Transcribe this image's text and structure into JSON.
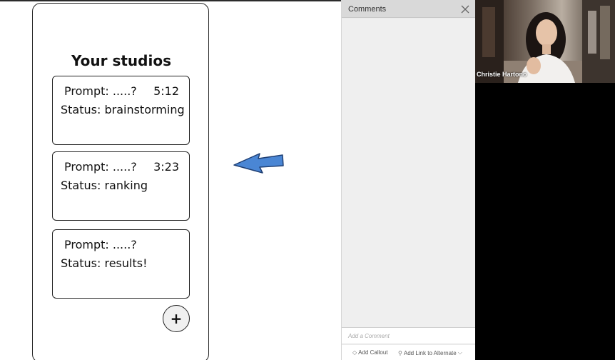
{
  "mockup": {
    "title": "Your studios",
    "cards": [
      {
        "prompt": "Prompt: .....?",
        "timer": "5:12",
        "status": "Status: brainstorming"
      },
      {
        "prompt": "Prompt: .....?",
        "timer": "3:23",
        "status": "Status: ranking"
      },
      {
        "prompt": "Prompt: .....?",
        "timer": "",
        "status": "Status: results!"
      }
    ],
    "add_button": "+",
    "arrow_color": "#4a86d4"
  },
  "comments": {
    "title": "Comments",
    "close_icon": "close-icon",
    "input_placeholder": "Add a Comment",
    "footer": {
      "add_callout": "Add Callout",
      "add_link": "Add Link to Alternate"
    }
  },
  "video": {
    "participant_name": "Christie Hartono"
  }
}
